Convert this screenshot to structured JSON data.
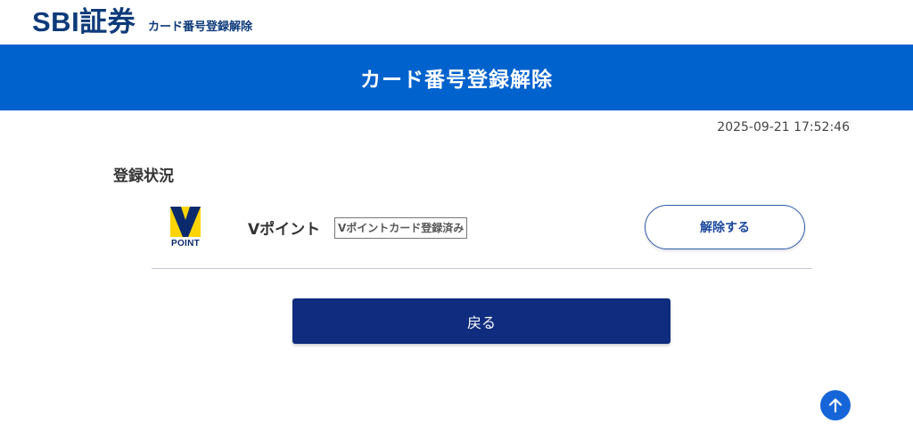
{
  "header": {
    "logo_text": "SBI証券",
    "logo_subtitle": "カード番号登録解除"
  },
  "banner": {
    "title": "カード番号登録解除",
    "background_color": "#0062cd"
  },
  "timestamp": "2025-09-21 17:52:46",
  "registration": {
    "section_title": "登録状況",
    "card": {
      "logo_icon": "v-point-logo-icon",
      "logo_word": "POINT",
      "name": "Vポイント",
      "status_badge": "Vポイントカード登録済み",
      "unregister_label": "解除する"
    }
  },
  "back_button": {
    "label": "戻る",
    "color": "#0f2c7e"
  },
  "scroll_top": {
    "icon": "arrow-up-icon",
    "color": "#1565d8"
  }
}
